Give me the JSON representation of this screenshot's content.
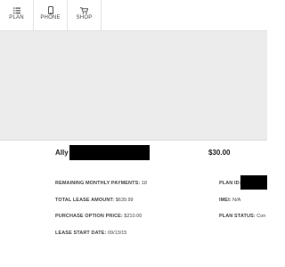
{
  "nav": {
    "items": [
      {
        "label": "PLAN",
        "icon": "plan-list-icon"
      },
      {
        "label": "PHONE",
        "icon": "phone-icon"
      },
      {
        "label": "SHOP",
        "icon": "cart-icon"
      }
    ]
  },
  "summary": {
    "name": "Ally",
    "price": "$30.00"
  },
  "details": {
    "remaining_monthly_payments": {
      "label": "REMAINING MONTHLY PAYMENTS:",
      "value": "18"
    },
    "total_lease_amount": {
      "label": "TOTAL LEASE AMOUNT:",
      "value": "$639.99"
    },
    "purchase_option_price": {
      "label": "PURCHASE OPTION PRICE:",
      "value": "$210.00"
    },
    "lease_start_date": {
      "label": "LEASE START DATE:",
      "value": "09/13/15"
    },
    "plan_id": {
      "label": "PLAN ID:",
      "value": ""
    },
    "imei": {
      "label": "IMEI:",
      "value": "N/A"
    },
    "plan_status": {
      "label": "PLAN STATUS:",
      "value": "Con"
    }
  },
  "colors": {
    "background": "#ffffff",
    "content_gray": "#ececec",
    "divider": "#dddddd",
    "redaction": "#000000"
  }
}
